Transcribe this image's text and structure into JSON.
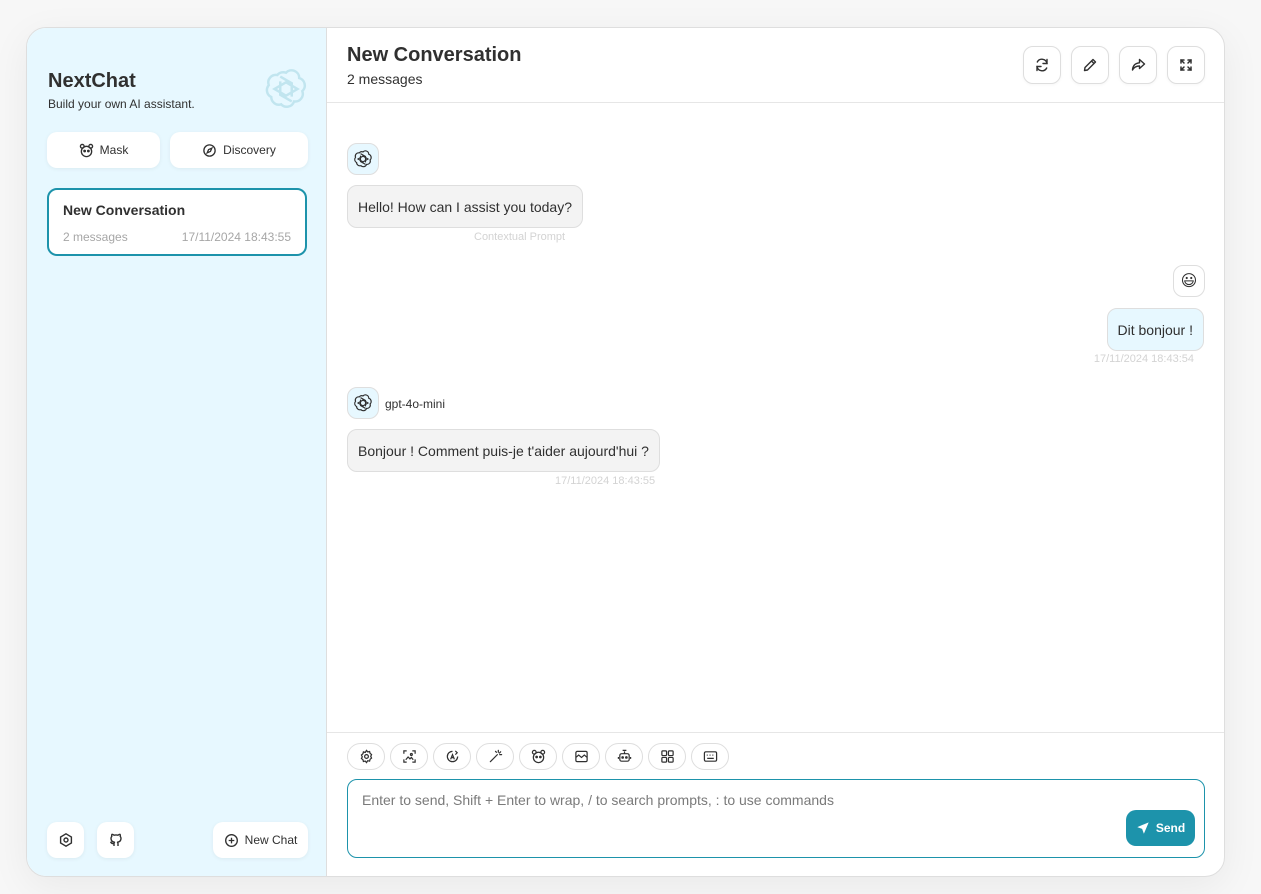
{
  "sidebar": {
    "title": "NextChat",
    "subtitle": "Build your own AI assistant.",
    "mask_label": "Mask",
    "discovery_label": "Discovery",
    "new_chat_label": "New Chat",
    "conversations": [
      {
        "title": "New Conversation",
        "count": "2 messages",
        "date": "17/11/2024 18:43:55"
      }
    ]
  },
  "header": {
    "title": "New Conversation",
    "subtitle": "2 messages"
  },
  "messages": [
    {
      "role": "assistant",
      "text": "Hello! How can I assist you today?",
      "meta": "Contextual Prompt"
    },
    {
      "role": "user",
      "avatar": "😃",
      "text": "Dit bonjour !",
      "meta": "17/11/2024 18:43:54"
    },
    {
      "role": "assistant",
      "model": "gpt-4o-mini",
      "text": "Bonjour ! Comment puis-je t'aider aujourd'hui ?",
      "meta": "17/11/2024 18:43:55"
    }
  ],
  "input": {
    "placeholder": "Enter to send, Shift + Enter to wrap, / to search prompts, : to use commands",
    "send_label": "Send"
  },
  "colors": {
    "accent": "#1d93ab",
    "sidebar_bg": "#e7f8ff",
    "bot_bubble": "#f3f3f3"
  },
  "icons": {
    "toolbar": [
      "settings-icon",
      "image-icon",
      "model-icon",
      "magic-wand-icon",
      "mask-icon",
      "overflow-icon",
      "robot-icon",
      "plugin-icon",
      "shortcut-icon"
    ],
    "header": [
      "refresh-icon",
      "edit-icon",
      "share-icon",
      "fullscreen-icon"
    ]
  }
}
